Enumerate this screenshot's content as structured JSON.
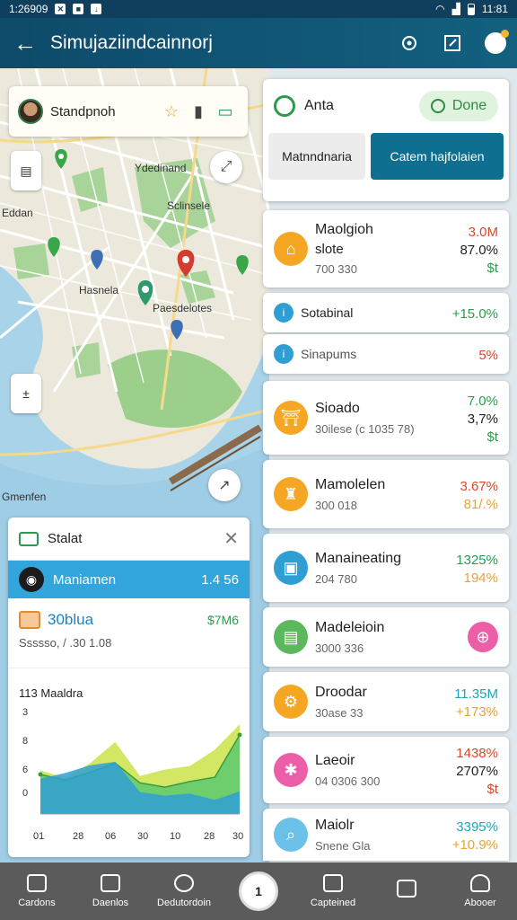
{
  "status_bar": {
    "time_left": "1:26909",
    "time_right": "11:81"
  },
  "app_bar": {
    "title": "Simujaziindcainnorj"
  },
  "map": {
    "place_card": {
      "name": "Standpnoh"
    },
    "labels": [
      "Ydedinand",
      "Sclinsele",
      "Eddan",
      "Hasnela",
      "Paesdelotes",
      "Gmenfen"
    ]
  },
  "stats_panel": {
    "title": "Stalat",
    "highlight": {
      "label": "Maniamen",
      "value": "1.4 56"
    },
    "row": {
      "label": "30blua",
      "value": "$7M6",
      "sub": "Ssssso, / .30 1.08"
    },
    "chart_title": "113 Maaldra"
  },
  "chart_data": {
    "type": "area",
    "title": "113 Maaldra",
    "x": [
      "01",
      "28",
      "06",
      "30",
      "10",
      "28",
      "30"
    ],
    "y_ticks": [
      "0",
      "6",
      "8",
      "3"
    ],
    "series": [
      {
        "color": "#cce34a",
        "values": [
          6.2,
          5.1,
          7.2,
          10.2,
          5.4,
          6.3,
          6.8,
          9.1,
          12.7
        ]
      },
      {
        "color": "#5cc86e",
        "values": [
          5.6,
          4.8,
          5.9,
          7.2,
          4.4,
          3.8,
          4.6,
          5.2,
          11.2
        ]
      },
      {
        "color": "#2f9fd3",
        "values": [
          5.0,
          5.8,
          6.9,
          7.4,
          3.1,
          2.6,
          2.9,
          2.0,
          3.2
        ]
      }
    ]
  },
  "top_card": {
    "name": "Anta",
    "done_label": "Done",
    "button_left": "Matnndnaria",
    "button_right": "Catem hajfolaien"
  },
  "items": [
    {
      "title": "Maolgioh",
      "subtitle": "slote",
      "detail": "700 330",
      "value1": "3.0M",
      "value2": "87.0%",
      "value3": "$t",
      "icon_color": "#f5a623",
      "value1_color": "#d9482b",
      "value2_color": "#222",
      "value3_color": "#2e9a4e"
    },
    {
      "title": "Sotabinal",
      "value1": "+15.0%",
      "icon_color": "#2f9fd3",
      "value1_color": "#2e9a4e"
    },
    {
      "title": "Sinapums",
      "value1": "5%",
      "icon_color": "#2f9fd3",
      "value1_color": "#d9482b"
    },
    {
      "title": "Sioado",
      "detail": "30ilese (c 1035 78)",
      "value1": "7.0%",
      "value2": "3,7%",
      "value3": "$t",
      "icon_color": "#f5a623",
      "value1_color": "#2e9a4e",
      "value2_color": "#222",
      "value3_color": "#2e9a4e"
    },
    {
      "title": "Mamolelen",
      "detail": "300 018",
      "value1": "3.67%",
      "value2": "81/.%",
      "icon_color": "#f5a623",
      "value1_color": "#d9482b",
      "value2_color": "#e8a23a"
    },
    {
      "title": "Manaineating",
      "detail": "204 780",
      "value1": "1325%",
      "value2": "194%",
      "icon_color": "#2f9fd3",
      "value1_color": "#2e9a4e",
      "value2_color": "#e8a23a"
    },
    {
      "title": "Madeleioin",
      "detail": "3000 336",
      "value1": "",
      "icon_color": "#5cb85c",
      "value1_color": "#222"
    },
    {
      "title": "Droodar",
      "detail": "30ase 33",
      "value1": "11.35M",
      "value2": "+173%",
      "icon_color": "#f5a623",
      "value1_color": "#1aa7b8",
      "value2_color": "#e8a23a"
    },
    {
      "title": "Laeoir",
      "detail": "04 0306 300",
      "value1": "1438%",
      "value2": "2707%",
      "value3": "$t",
      "icon_color": "#ec5ea8",
      "value1_color": "#d9482b",
      "value2_color": "#222",
      "value3_color": "#d9482b"
    },
    {
      "title": "Maiolr",
      "subtitle": "Snene Gla",
      "value1": "3395%",
      "value2": "+10.9%",
      "icon_color": "#6cc1e8",
      "value1_color": "#1aa7b8",
      "value2_color": "#e8a23a"
    }
  ],
  "bottom_nav": [
    "Cardons",
    "Daenlos",
    "Dedutordoin",
    "1",
    "Capteined",
    "",
    "Abooer"
  ]
}
